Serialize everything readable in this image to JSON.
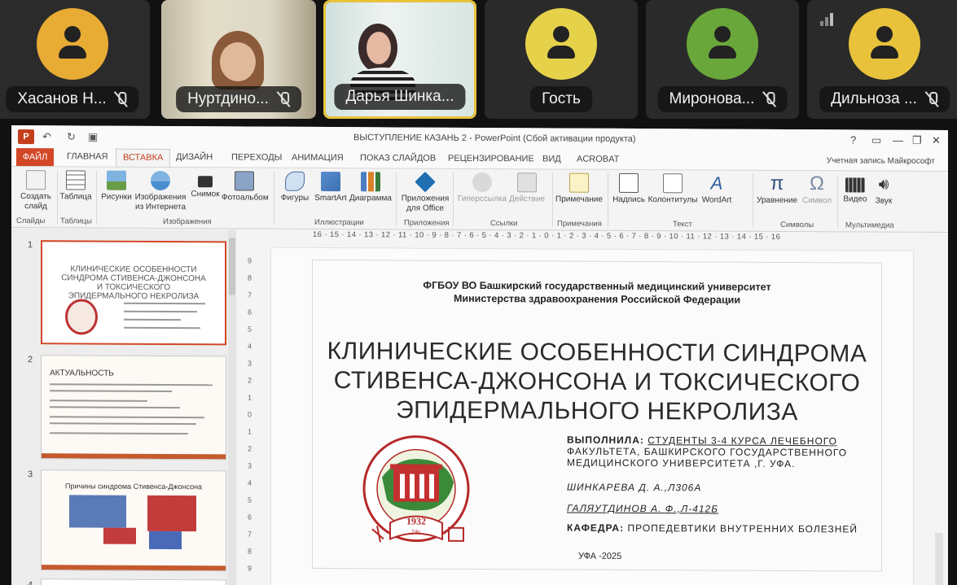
{
  "participants": [
    {
      "name": "Хасанов Н...",
      "avatar_color": "#e8ab34",
      "muted": true
    },
    {
      "name": "Нуртдино...",
      "video": true,
      "muted": true
    },
    {
      "name": "Дарья Шинка...",
      "video": true,
      "active": true
    },
    {
      "name": "Гость",
      "avatar_color": "#e6d24a",
      "muted": false
    },
    {
      "name": "Миронова...",
      "avatar_color": "#6aa73a",
      "muted": true
    },
    {
      "name": "Дильноза ...",
      "avatar_color": "#e8c23a",
      "muted": true
    }
  ],
  "window": {
    "title": "ВЫСТУПЛЕНИЕ КАЗАНЬ 2 - PowerPoint (Сбой активации продукта)",
    "account": "Учетная запись Майкрософт",
    "help": "?",
    "minimize": "—",
    "restore": "❐",
    "close": "✕"
  },
  "tabs": [
    "ФАЙЛ",
    "ГЛАВНАЯ",
    "ВСТАВКА",
    "ДИЗАЙН",
    "ПЕРЕХОДЫ",
    "АНИМАЦИЯ",
    "ПОКАЗ СЛАЙДОВ",
    "РЕЦЕНЗИРОВАНИЕ",
    "ВИД",
    "ACROBAT"
  ],
  "ribbon": {
    "buttons": [
      {
        "label": "Создать слайд",
        "icon": "new-slide-icon"
      },
      {
        "label": "Таблица",
        "icon": "table-icon"
      },
      {
        "label": "Рисунки",
        "icon": "pictures-icon"
      },
      {
        "label": "Изображения из Интернета",
        "icon": "online-pictures-icon"
      },
      {
        "label": "Снимок",
        "icon": "screenshot-icon"
      },
      {
        "label": "Фотоальбом",
        "icon": "photo-album-icon"
      },
      {
        "label": "Фигуры",
        "icon": "shapes-icon"
      },
      {
        "label": "SmartArt",
        "icon": "smartart-icon"
      },
      {
        "label": "Диаграмма",
        "icon": "chart-icon"
      },
      {
        "label": "Приложения для Office",
        "icon": "apps-icon"
      },
      {
        "label": "Гиперссылка",
        "icon": "hyperlink-icon",
        "disabled": true
      },
      {
        "label": "Действие",
        "icon": "action-icon",
        "disabled": true
      },
      {
        "label": "Примечание",
        "icon": "comment-icon"
      },
      {
        "label": "Надпись",
        "icon": "textbox-icon"
      },
      {
        "label": "Колонтитулы",
        "icon": "header-footer-icon"
      },
      {
        "label": "WordArt",
        "icon": "wordart-icon"
      },
      {
        "label": "Уравнение",
        "icon": "equation-icon"
      },
      {
        "label": "Символ",
        "icon": "symbol-icon",
        "disabled": true
      },
      {
        "label": "Видео",
        "icon": "video-icon"
      },
      {
        "label": "Звук",
        "icon": "audio-icon"
      }
    ],
    "groups": [
      "Слайды",
      "Таблицы",
      "Изображения",
      "Иллюстрации",
      "Приложения",
      "Ссылки",
      "Примечания",
      "Текст",
      "Символы",
      "Мультимедиа"
    ]
  },
  "thumbnails": [
    {
      "num": "1",
      "title": "КЛИНИЧЕСКИЕ ОСОБЕННОСТИ СИНДРОМА СТИВЕНСА-ДЖОНСОНА И ТОКСИЧЕСКОГО ЭПИДЕРМАЛЬНОГО НЕКРОЛИЗА"
    },
    {
      "num": "2",
      "title": "АКТУАЛЬНОСТЬ"
    },
    {
      "num": "3",
      "title": "Причины синдрома Стивенса-Джонсона"
    },
    {
      "num": "4",
      "title": ""
    }
  ],
  "ruler": "16 · 15 · 14 · 13 · 12 · 11 · 10 · 9 · 8 · 7 · 6 · 5 · 4 · 3 · 2 · 1 · 0 · 1 · 2 · 3 · 4 · 5 · 6 · 7 · 8 · 9 · 10 · 11 · 12 · 13 · 14 · 15 · 16",
  "vruler": [
    "9",
    "8",
    "7",
    "6",
    "5",
    "4",
    "3",
    "2",
    "1",
    "0",
    "1",
    "2",
    "3",
    "4",
    "5",
    "6",
    "7",
    "8",
    "9"
  ],
  "slide": {
    "university_line1": "ФГБОУ ВО Башкирский государственный медицинский университет",
    "university_line2": "Министерства здравоохранения Российской Федерации",
    "title_line1": "КЛИНИЧЕСКИЕ ОСОБЕННОСТИ СИНДРОМА",
    "title_line2": "СТИВЕНСА-ДЖОНСОНА И ТОКСИЧЕСКОГО",
    "title_line3": "ЭПИДЕРМАЛЬНОГО НЕКРОЛИЗА",
    "performed_label": "ВЫПОЛНИЛА:",
    "performed_text1": "СТУДЕНТЫ 3-4 КУРСА ЛЕЧЕБНОГО",
    "performed_text2": "ФАКУЛЬТЕТА, БАШКИРСКОГО ГОСУДАРСТВЕННОГО",
    "performed_text3": "МЕДИЦИНСКОГО УНИВЕРСИТЕТА ,Г. УФА.",
    "author1": "ШИНКАРЕВА Д. А.,Л306А",
    "author2": "ГАЛЯУТДИНОВ А. Ф.,Л-412Б",
    "dept_label": "КАФЕДРА:",
    "dept_text": "ПРОПЕДЕВТИКИ ВНУТРЕННИХ БОЛЕЗНЕЙ",
    "city": "УФА -2025",
    "seal_year": "1932",
    "seal_city": "Уфа"
  }
}
